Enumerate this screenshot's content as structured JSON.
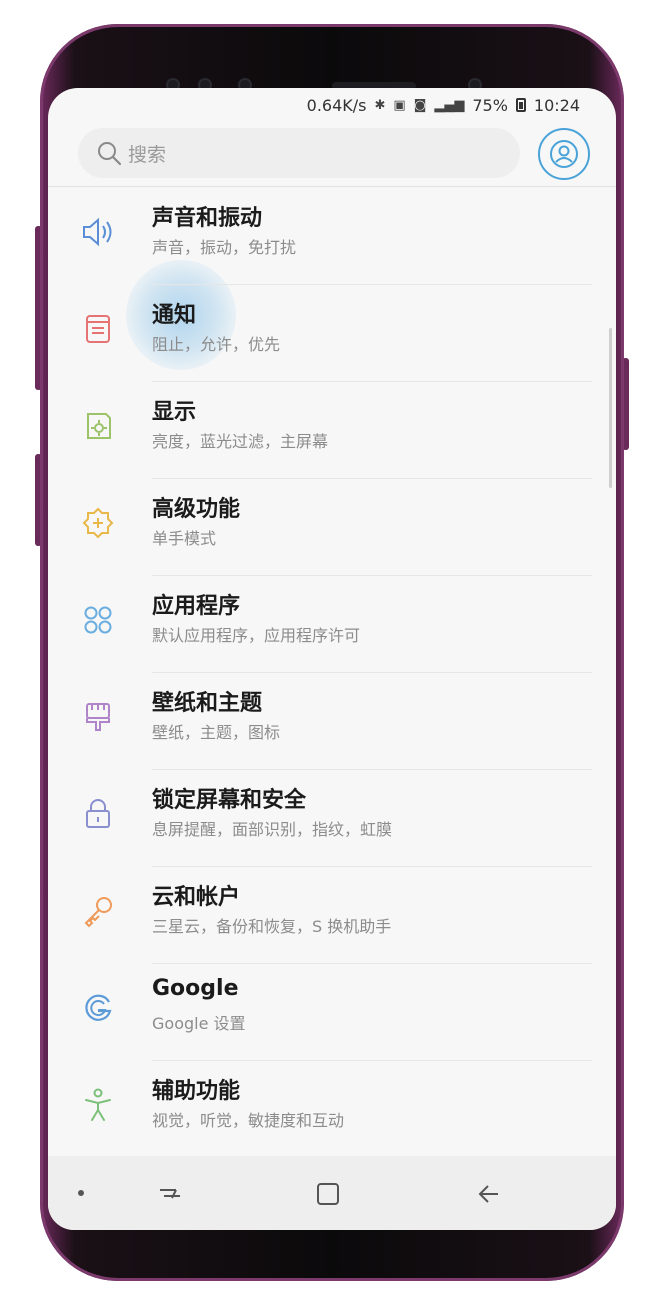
{
  "status_bar": {
    "speed": "0.64K/s",
    "icons": [
      "bluetooth-icon",
      "nfc-icon",
      "vibrate-icon",
      "signal-icon"
    ],
    "battery": "75%",
    "time": "10:24"
  },
  "search": {
    "placeholder": "搜索"
  },
  "settings": [
    {
      "title": "声音和振动",
      "subtitle": "声音，振动，免打扰",
      "icon": "speaker-icon",
      "color": "#5a8fd6"
    },
    {
      "title": "通知",
      "subtitle": "阻止，允许，优先",
      "icon": "notification-icon",
      "color": "#e57373"
    },
    {
      "title": "显示",
      "subtitle": "亮度，蓝光过滤，主屏幕",
      "icon": "display-icon",
      "color": "#9cc36a"
    },
    {
      "title": "高级功能",
      "subtitle": "单手模式",
      "icon": "advanced-gear-icon",
      "color": "#e8b84a"
    },
    {
      "title": "应用程序",
      "subtitle": "默认应用程序，应用程序许可",
      "icon": "apps-icon",
      "color": "#6aaee0"
    },
    {
      "title": "壁纸和主题",
      "subtitle": "壁纸，主题，图标",
      "icon": "brush-icon",
      "color": "#b084c9"
    },
    {
      "title": "锁定屏幕和安全",
      "subtitle": "息屏提醒，面部识别，指纹，虹膜",
      "icon": "lock-icon",
      "color": "#8a8fd0"
    },
    {
      "title": "云和帐户",
      "subtitle": "三星云，备份和恢复，S 换机助手",
      "icon": "key-icon",
      "color": "#ef9a5a"
    },
    {
      "title": "Google",
      "subtitle": "Google 设置",
      "icon": "google-icon",
      "color": "#5c9bd8"
    },
    {
      "title": "辅助功能",
      "subtitle": "视觉，听觉，敏捷度和互动",
      "icon": "accessibility-icon",
      "color": "#7cc07a"
    }
  ]
}
